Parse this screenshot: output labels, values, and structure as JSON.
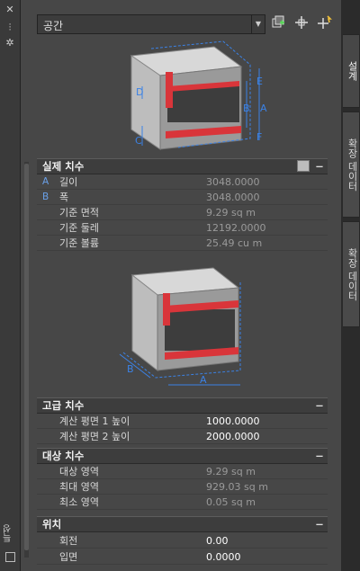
{
  "strip": {
    "close": "✕",
    "pin": "⫶",
    "gear": "✲",
    "palette_label": "특성"
  },
  "combo": {
    "value": "공간"
  },
  "diagram": {
    "top_labels": [
      "D",
      "E",
      "B",
      "A",
      "C",
      "F"
    ],
    "bottom_labels": [
      "B",
      "A"
    ]
  },
  "sections": {
    "actual": {
      "title": "실제 치수",
      "collapse": "−"
    },
    "advanced": {
      "title": "고급 치수",
      "collapse": "−"
    },
    "target": {
      "title": "대상 치수",
      "collapse": "−"
    },
    "location": {
      "title": "위치",
      "collapse": "−"
    }
  },
  "actual_rows": [
    {
      "key": "A",
      "label": "길이",
      "value": "3048.0000"
    },
    {
      "key": "B",
      "label": "폭",
      "value": "3048.0000"
    },
    {
      "key": "",
      "label": "기준 면적",
      "value": "9.29 sq m"
    },
    {
      "key": "",
      "label": "기준 둘레",
      "value": "12192.0000"
    },
    {
      "key": "",
      "label": "기준 볼륨",
      "value": "25.49  cu m"
    }
  ],
  "advanced_rows": [
    {
      "label": "계산 평면 1 높이",
      "value": "1000.0000"
    },
    {
      "label": "계산 평면 2 높이",
      "value": "2000.0000"
    }
  ],
  "target_rows": [
    {
      "label": "대상 영역",
      "value": "9.29 sq m"
    },
    {
      "label": "최대 영역",
      "value": "929.03 sq m"
    },
    {
      "label": "최소 영역",
      "value": "0.05 sq m"
    }
  ],
  "location_rows": [
    {
      "label": "회전",
      "value": "0.00"
    },
    {
      "label": "입면",
      "value": "0.0000"
    }
  ],
  "tabs": [
    "설계",
    "확장 데이터",
    "확장 데이터"
  ],
  "colors": {
    "accent_red": "#d9353a",
    "dim_blue": "#3b82e6"
  }
}
